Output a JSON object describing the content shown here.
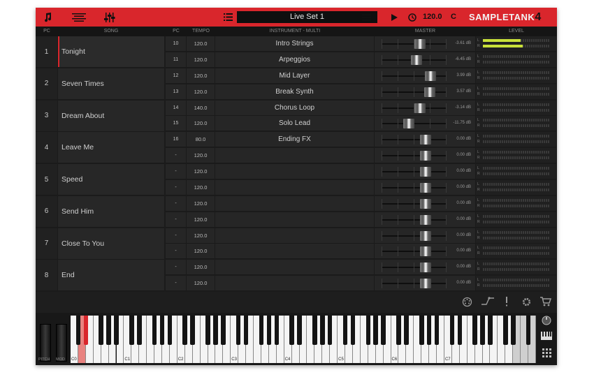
{
  "topbar": {
    "set_name": "Live Set 1",
    "tempo": "120.0",
    "key": "C",
    "logo": "SAMPLETANK",
    "logo_num": "4",
    "icons": [
      "note-icon",
      "lines-icon",
      "sliders-icon",
      "list-icon",
      "menu-icon",
      "play-icon",
      "clock-icon"
    ]
  },
  "columns": {
    "pc": "PC",
    "song": "SONG",
    "slot_pc": "PC",
    "tempo": "TEMPO",
    "instrument": "INSTRUMENT - MULTI",
    "master": "MASTER",
    "level": "LEVEL"
  },
  "songs": [
    {
      "pc": "1",
      "name": "Tonight"
    },
    {
      "pc": "2",
      "name": "Seven Times"
    },
    {
      "pc": "3",
      "name": "Dream About"
    },
    {
      "pc": "4",
      "name": "Leave Me"
    },
    {
      "pc": "5",
      "name": "Speed"
    },
    {
      "pc": "6",
      "name": "Send Him"
    },
    {
      "pc": "7",
      "name": "Close To You"
    },
    {
      "pc": "8",
      "name": "End"
    }
  ],
  "slots": [
    {
      "pc": "10",
      "tempo": "120.0",
      "instrument": "Intro Strings",
      "db": "-3.61 dB",
      "fader": 0.6,
      "level": 0.56
    },
    {
      "pc": "11",
      "tempo": "120.0",
      "instrument": "Arpeggios",
      "db": "-6.45 dB",
      "fader": 0.54,
      "level": 0
    },
    {
      "pc": "12",
      "tempo": "120.0",
      "instrument": "Mid Layer",
      "db": "3.99 dB",
      "fader": 0.76,
      "level": 0
    },
    {
      "pc": "13",
      "tempo": "120.0",
      "instrument": "Break Synth",
      "db": "3.57 dB",
      "fader": 0.75,
      "level": 0
    },
    {
      "pc": "14",
      "tempo": "140.0",
      "instrument": "Chorus Loop",
      "db": "-3.14 dB",
      "fader": 0.6,
      "level": 0
    },
    {
      "pc": "15",
      "tempo": "120.0",
      "instrument": "Solo Lead",
      "db": "-11.75 dB",
      "fader": 0.42,
      "level": 0
    },
    {
      "pc": "16",
      "tempo": "80.0",
      "instrument": "Ending FX",
      "db": "0.00 dB",
      "fader": 0.68,
      "level": 0
    },
    {
      "pc": "-",
      "tempo": "120.0",
      "instrument": "",
      "db": "0.00 dB",
      "fader": 0.68,
      "level": 0
    },
    {
      "pc": "-",
      "tempo": "120.0",
      "instrument": "",
      "db": "0.00 dB",
      "fader": 0.68,
      "level": 0
    },
    {
      "pc": "-",
      "tempo": "120.0",
      "instrument": "",
      "db": "0.00 dB",
      "fader": 0.68,
      "level": 0
    },
    {
      "pc": "-",
      "tempo": "120.0",
      "instrument": "",
      "db": "0.00 dB",
      "fader": 0.68,
      "level": 0
    },
    {
      "pc": "-",
      "tempo": "120.0",
      "instrument": "",
      "db": "0.00 dB",
      "fader": 0.68,
      "level": 0
    },
    {
      "pc": "-",
      "tempo": "120.0",
      "instrument": "",
      "db": "0.00 dB",
      "fader": 0.68,
      "level": 0
    },
    {
      "pc": "-",
      "tempo": "120.0",
      "instrument": "",
      "db": "0.00 dB",
      "fader": 0.68,
      "level": 0
    },
    {
      "pc": "-",
      "tempo": "120.0",
      "instrument": "",
      "db": "0.00 dB",
      "fader": 0.68,
      "level": 0
    },
    {
      "pc": "-",
      "tempo": "120.0",
      "instrument": "",
      "db": "0.00 dB",
      "fader": 0.68,
      "level": 0
    }
  ],
  "meter_labels": {
    "l": "L",
    "r": "R"
  },
  "keyboard": {
    "pitch_label": "PITCH",
    "mod_label": "MOD",
    "octave_labels": [
      "C0",
      "C1",
      "C2",
      "C3",
      "C4",
      "C5",
      "C6",
      "C7"
    ],
    "highlight_color": "#e8827f",
    "accent_color": "#d9262c"
  },
  "lower_icons": [
    "dial-icon",
    "curve-icon",
    "alert-icon",
    "gear-icon",
    "cart-icon"
  ],
  "side_icons": [
    "knob-icon",
    "keyboard-icon",
    "grid-icon"
  ]
}
